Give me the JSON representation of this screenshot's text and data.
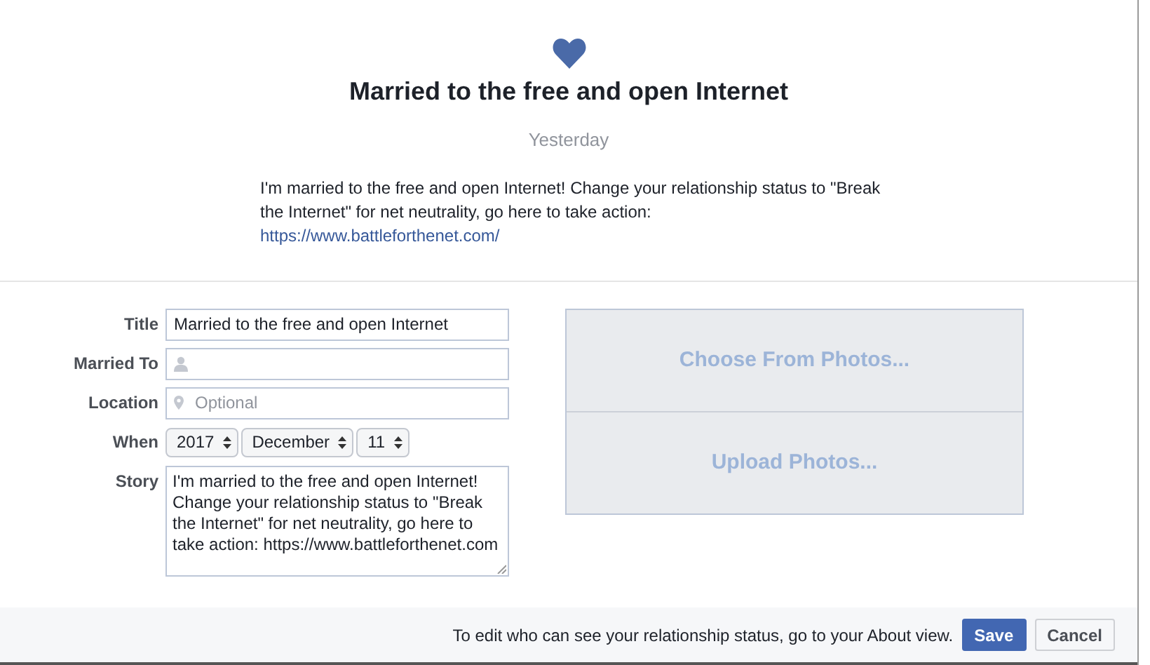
{
  "post": {
    "title": "Married to the free and open Internet",
    "date": "Yesterday",
    "text": "I'm married to the free and open Internet! Change your relationship status to \"Break the Internet\" for net neutrality, go here to take action:",
    "link": "https://www.battleforthenet.com/"
  },
  "form": {
    "fields": [
      {
        "kind": "text",
        "label": "Title",
        "value": "Married to the free and open Internet"
      },
      {
        "kind": "person",
        "label": "Married To"
      },
      {
        "kind": "place",
        "label": "Location",
        "placeholder": "Optional"
      },
      {
        "kind": "date",
        "label": "When",
        "selects": [
          "2017",
          "December",
          "11"
        ]
      },
      {
        "kind": "story",
        "label": "Story",
        "value": "I'm married to the free and open Internet! Change your relationship status to \"Break the Internet\" for net neutrality, go here to take action: https://www.battleforthenet.com"
      }
    ]
  },
  "photos": {
    "buttons": [
      "Choose From Photos...",
      "Upload Photos..."
    ]
  },
  "footer": {
    "note": "To edit who can see your relationship status, go to your About view.",
    "buttons": [
      {
        "label": "Save",
        "kind": "primary"
      },
      {
        "label": "Cancel",
        "kind": "secondary"
      }
    ]
  }
}
